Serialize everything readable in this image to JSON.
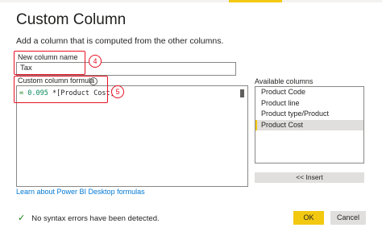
{
  "dialog": {
    "title": "Custom Column",
    "subtitle": "Add a column that is computed from the other columns."
  },
  "name_field": {
    "label": "New column name",
    "value": "Tax"
  },
  "formula_field": {
    "label": "Custom column formula",
    "info_icon": "i",
    "equals": "=",
    "number": "0.095",
    "rest": " *[Product Cost]"
  },
  "annotations": {
    "step_name": "4",
    "step_formula": "5"
  },
  "available_columns": {
    "label": "Available columns",
    "items": [
      "Product Code",
      "Product line",
      "Product type/Product",
      "Product Cost"
    ],
    "selected_index": 3,
    "insert_label": "<< Insert"
  },
  "learn_link": "Learn about Power BI Desktop formulas",
  "status": {
    "icon": "check-icon",
    "text": "No syntax errors have been detected."
  },
  "buttons": {
    "ok": "OK",
    "cancel": "Cancel"
  },
  "colors": {
    "accent": "#f2c811",
    "annotation_red": "#e81123",
    "link": "#0078d4",
    "success": "#107c10"
  }
}
